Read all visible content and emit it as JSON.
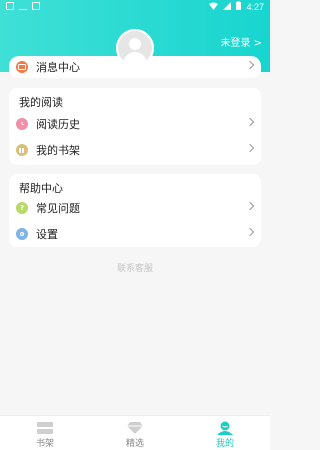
{
  "status_bar": {
    "time": "4:27"
  },
  "header": {
    "login_link": "未登录 >"
  },
  "top_card": {
    "item": {
      "label": "消息中心",
      "icon": "message-icon",
      "color": "#f07a4a"
    }
  },
  "reading": {
    "title": "我的阅读",
    "items": [
      {
        "label": "阅读历史",
        "icon": "clock-icon",
        "color": "#f08fa5"
      },
      {
        "label": "我的书架",
        "icon": "bookshelf-icon",
        "color": "#d8c07a"
      }
    ]
  },
  "help": {
    "title": "帮助中心",
    "items": [
      {
        "label": "常见问题",
        "icon": "question-icon",
        "color": "#b7d96a"
      },
      {
        "label": "设置",
        "icon": "settings-icon",
        "color": "#7fb4e6"
      }
    ]
  },
  "contact_text": "联系客服",
  "tabbar": {
    "tabs": [
      {
        "label": "书架",
        "icon": "bookshelf-tab-icon"
      },
      {
        "label": "精选",
        "icon": "diamond-icon"
      },
      {
        "label": "我的",
        "icon": "profile-icon"
      }
    ],
    "active_color": "#1ecdc4"
  },
  "colors": {
    "accent": "#1ecdc4"
  }
}
